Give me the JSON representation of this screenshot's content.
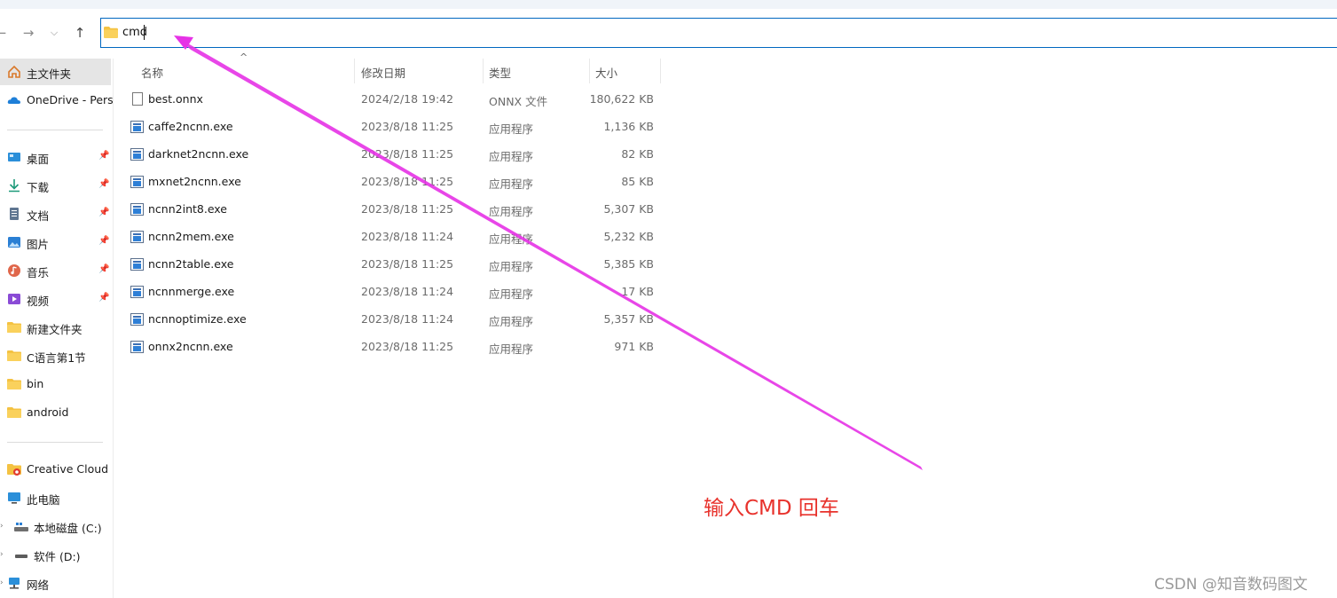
{
  "nav": {
    "back_icon": "back-arrow-icon",
    "forward_icon": "forward-arrow-icon",
    "recent_icon": "chevron-down-icon",
    "up_icon": "up-arrow-icon",
    "address_value": "cmd"
  },
  "sidebar": {
    "items": [
      {
        "label": "主文件夹",
        "icon": "home-icon",
        "pinned": false,
        "selected": true
      },
      {
        "label": "OneDrive - Perso",
        "icon": "cloud-icon",
        "pinned": false
      },
      {
        "label": "桌面",
        "icon": "desktop-icon",
        "pinned": true
      },
      {
        "label": "下载",
        "icon": "download-icon",
        "pinned": true
      },
      {
        "label": "文档",
        "icon": "document-icon",
        "pinned": true
      },
      {
        "label": "图片",
        "icon": "pictures-icon",
        "pinned": true
      },
      {
        "label": "音乐",
        "icon": "music-icon",
        "pinned": true
      },
      {
        "label": "视频",
        "icon": "video-icon",
        "pinned": true
      },
      {
        "label": "新建文件夹",
        "icon": "folder-icon"
      },
      {
        "label": "C语言第1节",
        "icon": "folder-icon"
      },
      {
        "label": "bin",
        "icon": "folder-icon"
      },
      {
        "label": "android",
        "icon": "folder-icon"
      },
      {
        "label": "Creative Cloud F",
        "icon": "creative-cloud-icon"
      },
      {
        "label": "此电脑",
        "icon": "computer-icon"
      },
      {
        "label": "本地磁盘 (C:)",
        "icon": "drive-icon"
      },
      {
        "label": "软件 (D:)",
        "icon": "drive-icon"
      },
      {
        "label": "网络",
        "icon": "network-icon"
      }
    ],
    "pin_glyph": "📌"
  },
  "columns": {
    "name": "名称",
    "date": "修改日期",
    "type": "类型",
    "size": "大小"
  },
  "files": [
    {
      "name": "best.onnx",
      "date": "2024/2/18 19:42",
      "type": "ONNX 文件",
      "size": "180,622 KB",
      "icon": "file-icon"
    },
    {
      "name": "caffe2ncnn.exe",
      "date": "2023/8/18 11:25",
      "type": "应用程序",
      "size": "1,136 KB",
      "icon": "exe-icon"
    },
    {
      "name": "darknet2ncnn.exe",
      "date": "2023/8/18 11:25",
      "type": "应用程序",
      "size": "82 KB",
      "icon": "exe-icon"
    },
    {
      "name": "mxnet2ncnn.exe",
      "date": "2023/8/18 11:25",
      "type": "应用程序",
      "size": "85 KB",
      "icon": "exe-icon"
    },
    {
      "name": "ncnn2int8.exe",
      "date": "2023/8/18 11:25",
      "type": "应用程序",
      "size": "5,307 KB",
      "icon": "exe-icon"
    },
    {
      "name": "ncnn2mem.exe",
      "date": "2023/8/18 11:24",
      "type": "应用程序",
      "size": "5,232 KB",
      "icon": "exe-icon"
    },
    {
      "name": "ncnn2table.exe",
      "date": "2023/8/18 11:25",
      "type": "应用程序",
      "size": "5,385 KB",
      "icon": "exe-icon"
    },
    {
      "name": "ncnnmerge.exe",
      "date": "2023/8/18 11:24",
      "type": "应用程序",
      "size": "17 KB",
      "icon": "exe-icon"
    },
    {
      "name": "ncnnoptimize.exe",
      "date": "2023/8/18 11:24",
      "type": "应用程序",
      "size": "5,357 KB",
      "icon": "exe-icon"
    },
    {
      "name": "onnx2ncnn.exe",
      "date": "2023/8/18 11:25",
      "type": "应用程序",
      "size": "971 KB",
      "icon": "exe-icon"
    }
  ],
  "annotation": {
    "text": "输入CMD 回车",
    "color": "#e8322c",
    "arrow_color": "#e632e6"
  },
  "watermark": "CSDN @知音数码图文",
  "colors": {
    "accent": "#0067c0",
    "folder": "#f4c242",
    "selected_bg": "#e5e5e5"
  }
}
